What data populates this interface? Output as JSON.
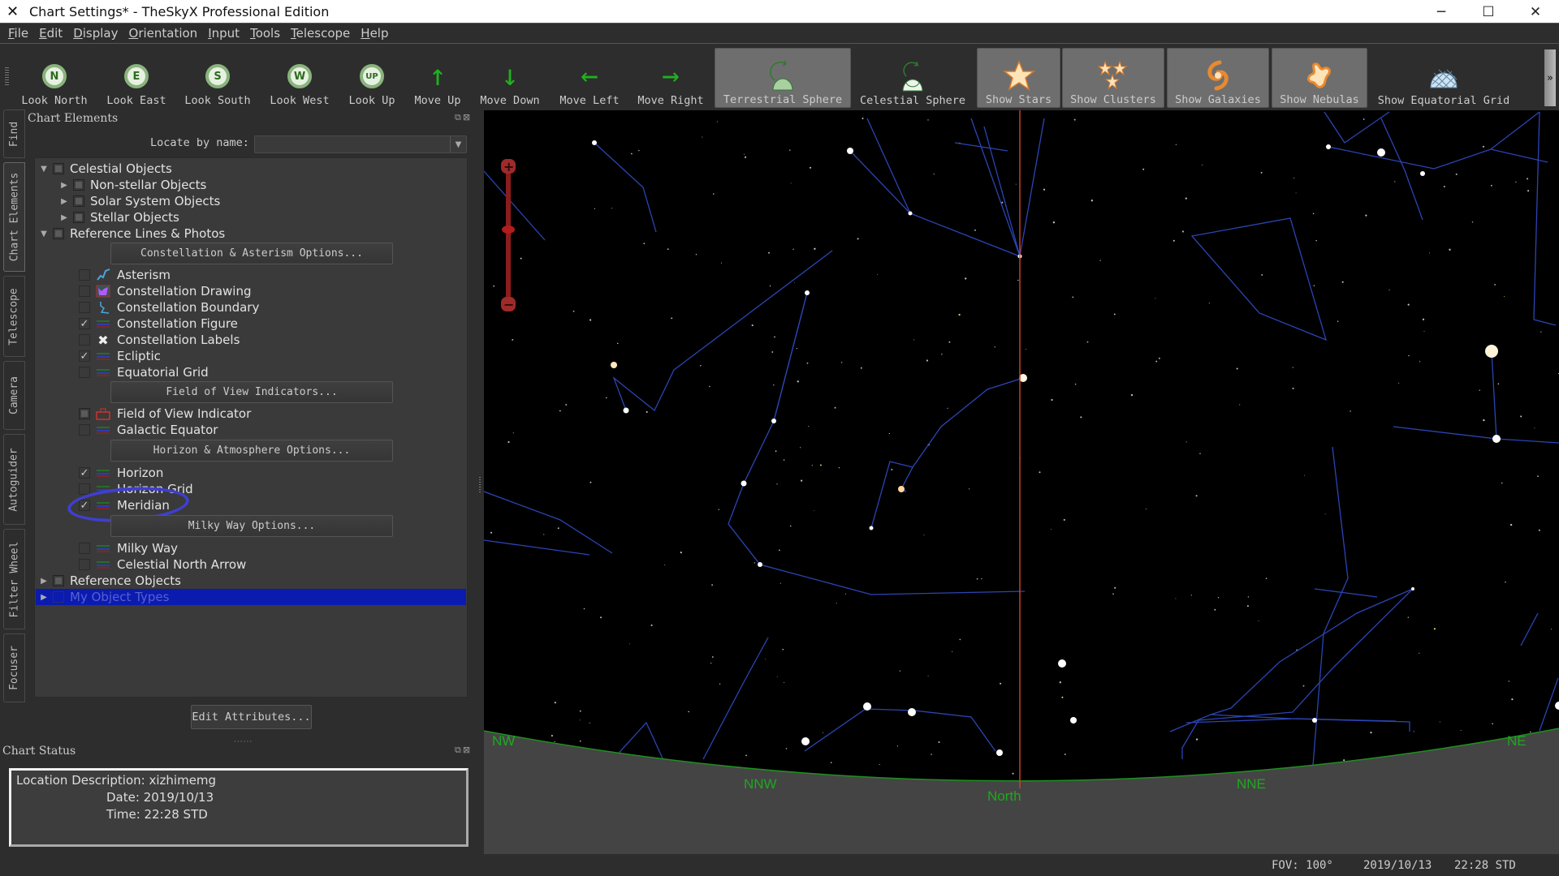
{
  "window": {
    "title": "Chart Settings* - TheSkyX Professional Edition",
    "logo_icon": "x-logo-icon",
    "controls": [
      "minimize",
      "maximize",
      "close"
    ]
  },
  "menu": [
    "File",
    "Edit",
    "Display",
    "Orientation",
    "Input",
    "Tools",
    "Telescope",
    "Help"
  ],
  "toolbar": {
    "buttons": [
      {
        "label": "Look North",
        "icon": "N",
        "active": false
      },
      {
        "label": "Look East",
        "icon": "E",
        "active": false
      },
      {
        "label": "Look South",
        "icon": "S",
        "active": false
      },
      {
        "label": "Look West",
        "icon": "W",
        "active": false
      },
      {
        "label": "Look Up",
        "icon": "UP",
        "active": false
      },
      {
        "label": "Move Up",
        "icon": "arrow-up-icon",
        "active": false
      },
      {
        "label": "Move Down",
        "icon": "arrow-down-icon",
        "active": false
      },
      {
        "label": "Move Left",
        "icon": "arrow-left-icon",
        "active": false
      },
      {
        "label": "Move Right",
        "icon": "arrow-right-icon",
        "active": false
      },
      {
        "label": "Terrestrial Sphere",
        "icon": "terrestrial-sphere-icon",
        "active": true
      },
      {
        "label": "Celestial Sphere",
        "icon": "celestial-sphere-icon",
        "active": false
      },
      {
        "label": "Show Stars",
        "icon": "star-icon",
        "active": true
      },
      {
        "label": "Show Clusters",
        "icon": "clusters-icon",
        "active": true
      },
      {
        "label": "Show Galaxies",
        "icon": "galaxy-icon",
        "active": true
      },
      {
        "label": "Show Nebulas",
        "icon": "nebula-icon",
        "active": true
      },
      {
        "label": "Show Equatorial Grid",
        "icon": "equatorial-grid-icon",
        "active": false
      }
    ],
    "overflow_label": "»"
  },
  "side_tabs": [
    "Find",
    "Chart Elements",
    "Telescope",
    "Camera",
    "Autoguider",
    "Filter Wheel",
    "Focuser"
  ],
  "chart_elements": {
    "title": "Chart Elements",
    "locate_label": "Locate by name:",
    "locate_value": "",
    "tree": [
      {
        "label": "Celestial Objects",
        "level": 0,
        "expander": "expanded",
        "check": "partial"
      },
      {
        "label": "Non-stellar Objects",
        "level": 1,
        "expander": "collapsed",
        "check": "partial"
      },
      {
        "label": "Solar System Objects",
        "level": 1,
        "expander": "collapsed",
        "check": "partial"
      },
      {
        "label": "Stellar Objects",
        "level": 1,
        "expander": "collapsed",
        "check": "partial"
      },
      {
        "label": "Reference Lines & Photos",
        "level": 0,
        "expander": "expanded",
        "check": "partial"
      }
    ],
    "options_buttons": {
      "constellation": "Constellation & Asterism Options...",
      "fov": "Field of View Indicators...",
      "horizon": "Horizon & Atmosphere Options...",
      "milky_way": "Milky Way Options..."
    },
    "items": [
      {
        "label": "Asterism",
        "checked": false,
        "icon": "asterism-icon"
      },
      {
        "label": "Constellation Drawing",
        "checked": false,
        "icon": "constellation-drawing-icon"
      },
      {
        "label": "Constellation Boundary",
        "checked": false,
        "icon": "constellation-boundary-icon"
      },
      {
        "label": "Constellation Figure",
        "checked": true,
        "icon": "line-style-icon"
      },
      {
        "label": "Constellation Labels",
        "checked": false,
        "icon": "labels-x-icon"
      },
      {
        "label": "Ecliptic",
        "checked": true,
        "icon": "line-style-icon"
      },
      {
        "label": "Equatorial Grid",
        "checked": false,
        "icon": "line-style-icon"
      },
      {
        "label": "Field of View Indicator",
        "checked": "partial",
        "icon": "fov-indicator-icon"
      },
      {
        "label": "Galactic Equator",
        "checked": false,
        "icon": "line-style-icon"
      },
      {
        "label": "Horizon",
        "checked": true,
        "icon": "line-style-icon"
      },
      {
        "label": "Horizon Grid",
        "checked": false,
        "icon": "line-style-icon"
      },
      {
        "label": "Meridian",
        "checked": true,
        "icon": "line-style-icon"
      },
      {
        "label": "Milky Way",
        "checked": false,
        "icon": "line-style-icon"
      },
      {
        "label": "Celestial North Arrow",
        "checked": false,
        "icon": "line-style-icon"
      }
    ],
    "bottom_tree": [
      {
        "label": "Reference Objects",
        "expander": "collapsed",
        "check": "partial",
        "selected": false
      },
      {
        "label": "My Object Types",
        "expander": "collapsed",
        "check": "none",
        "selected": true
      }
    ],
    "edit_button": "Edit Attributes...",
    "annotation": "hand-drawn circle around Meridian"
  },
  "chart_status": {
    "title": "Chart Status",
    "location_label": "Location Description:",
    "location_value": "xizhimemg",
    "date_label": "Date:",
    "date_value": "2019/10/13",
    "time_label": "Time:",
    "time_value": "22:28 STD"
  },
  "sky_chart": {
    "horizon_labels": [
      "NW",
      "NNW",
      "North",
      "NNE",
      "NE"
    ],
    "meridian_color": "#c8402a",
    "horizon_line_color": "#1f8f1f",
    "ground_color": "#444444",
    "constellation_line_color": "#2b45b5",
    "zoom_slider": {
      "plus": "+",
      "minus": "−",
      "level": 0.5
    }
  },
  "status_bar": {
    "fov": "FOV: 100°",
    "date": "2019/10/13",
    "time": "22:28 STD"
  }
}
